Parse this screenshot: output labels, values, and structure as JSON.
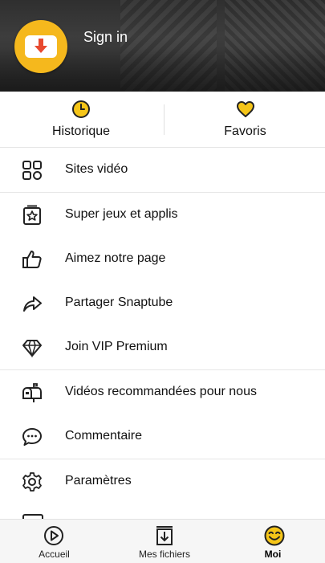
{
  "header": {
    "signin_label": "Sign in"
  },
  "quick": {
    "history_label": "Historique",
    "favorites_label": "Favoris"
  },
  "menu": {
    "items": [
      {
        "label": "Sites vidéo",
        "icon": "grid-icon"
      },
      {
        "label": "Super jeux et applis",
        "icon": "star-box-icon"
      },
      {
        "label": "Aimez notre page",
        "icon": "thumbs-up-icon"
      },
      {
        "label": "Partager Snaptube",
        "icon": "share-icon"
      },
      {
        "label": "Join VIP Premium",
        "icon": "diamond-icon"
      },
      {
        "label": "Vidéos recommandées pour nous",
        "icon": "mailbox-icon"
      },
      {
        "label": "Commentaire",
        "icon": "comment-icon"
      },
      {
        "label": "Paramètres",
        "icon": "gear-icon"
      }
    ]
  },
  "bottom_nav": {
    "home_label": "Accueil",
    "files_label": "Mes fichiers",
    "me_label": "Moi"
  },
  "colors": {
    "accent": "#f5b81d",
    "header_bg": "#333333"
  }
}
